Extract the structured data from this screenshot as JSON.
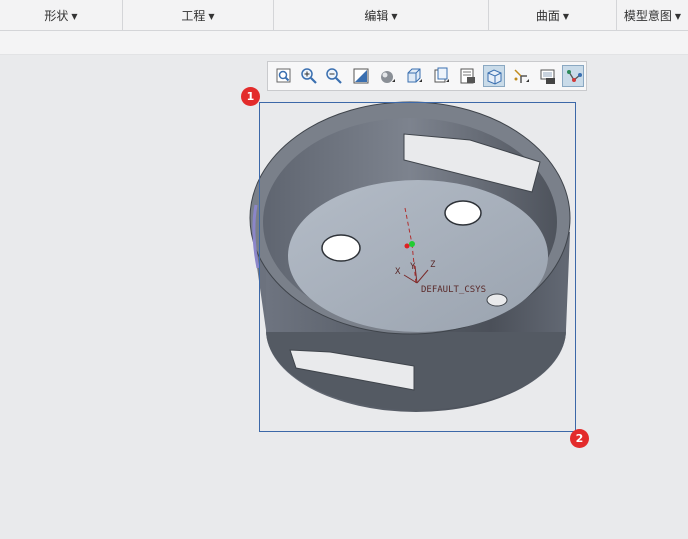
{
  "ribbon": {
    "groups": [
      {
        "label": "形状",
        "icon": "chevron-down-icon"
      },
      {
        "label": "工程",
        "icon": "chevron-down-icon"
      },
      {
        "label": "编辑",
        "icon": "chevron-down-icon"
      },
      {
        "label": "曲面",
        "icon": "chevron-down-icon"
      },
      {
        "label": "模型意图",
        "icon": "chevron-down-icon"
      }
    ]
  },
  "graphics_toolbar": {
    "tools": [
      {
        "icon": "refit-icon"
      },
      {
        "icon": "zoom-in-icon"
      },
      {
        "icon": "zoom-out-icon"
      },
      {
        "icon": "repaint-icon"
      },
      {
        "icon": "display-style-icon"
      },
      {
        "icon": "saved-orientations-icon"
      },
      {
        "icon": "view-manager-icon"
      },
      {
        "icon": "perspective-icon"
      },
      {
        "icon": "spin-center-icon",
        "active": true
      },
      {
        "icon": "datum-display-icon"
      },
      {
        "icon": "annotation-display-icon"
      },
      {
        "icon": "appearance-icon",
        "active": true
      }
    ]
  },
  "viewport": {
    "csys_label": "DEFAULT_CSYS",
    "axis_x": "X",
    "axis_y": "Y",
    "axis_z": "Z",
    "markers": [
      "1",
      "2"
    ]
  },
  "colors": {
    "selection_box": "#3c68a8",
    "marker": "#e32b2b",
    "model_body": "#5a606a",
    "model_floor": "#a9b1bc"
  }
}
